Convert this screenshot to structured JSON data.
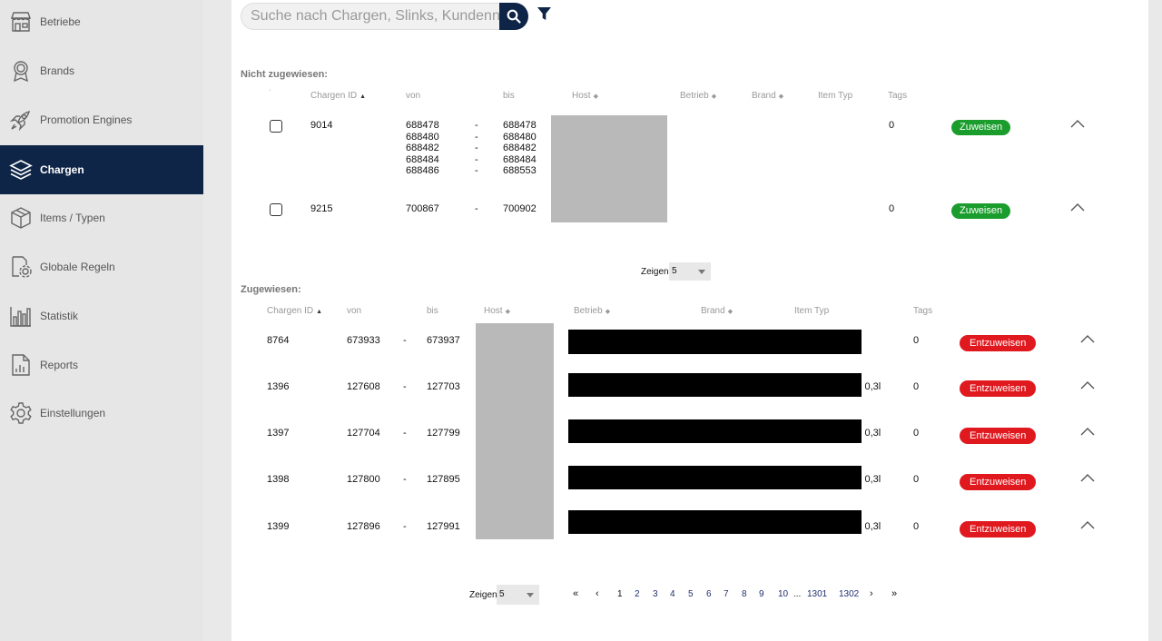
{
  "sidebar": {
    "items": [
      {
        "label": "Betriebe",
        "icon": "store-icon",
        "active": false
      },
      {
        "label": "Brands",
        "icon": "award-icon",
        "active": false
      },
      {
        "label": "Promotion Engines",
        "icon": "rocket-icon",
        "active": false
      },
      {
        "label": "Chargen",
        "icon": "layers-icon",
        "active": true
      },
      {
        "label": "Items / Typen",
        "icon": "box-icon",
        "active": false
      },
      {
        "label": "Globale Regeln",
        "icon": "settings-doc-icon",
        "active": false
      },
      {
        "label": "Statistik",
        "icon": "bar-chart-icon",
        "active": false
      },
      {
        "label": "Reports",
        "icon": "report-icon",
        "active": false
      },
      {
        "label": "Einstellungen",
        "icon": "gear-icon",
        "active": false
      }
    ]
  },
  "search": {
    "placeholder": "Suche nach Chargen, Slinks, Kundennummer"
  },
  "unassigned": {
    "title": "Nicht zugewiesen:",
    "headers": {
      "id": "Chargen ID",
      "from": "von",
      "to": "bis",
      "host": "Host",
      "betrieb": "Betrieb",
      "brand": "Brand",
      "item_type": "Item Typ",
      "tags": "Tags"
    },
    "rows": [
      {
        "id": "9014",
        "from": "688478\n688480\n688482\n688484\n688486",
        "dash": "-\n-\n-\n-\n-",
        "to": "688478\n688480\n688482\n688484\n688553",
        "tags": "0",
        "action": "Zuweisen"
      },
      {
        "id": "9215",
        "from": "700867",
        "dash": "-",
        "to": "700902",
        "tags": "0",
        "action": "Zuweisen"
      }
    ],
    "show_label": "Zeigen",
    "show_value": "5"
  },
  "assigned": {
    "title": "Zugewiesen:",
    "headers": {
      "id": "Chargen ID",
      "from": "von",
      "to": "bis",
      "host": "Host",
      "betrieb": "Betrieb",
      "brand": "Brand",
      "item_type": "Item Typ",
      "tags": "Tags"
    },
    "rows": [
      {
        "id": "8764",
        "from": "673933",
        "dash": "-",
        "to": "673937",
        "item_type": "",
        "tags": "0",
        "action": "Entzuweisen"
      },
      {
        "id": "1396",
        "from": "127608",
        "dash": "-",
        "to": "127703",
        "item_type": "l 0,3l",
        "tags": "0",
        "action": "Entzuweisen"
      },
      {
        "id": "1397",
        "from": "127704",
        "dash": "-",
        "to": "127799",
        "item_type": "l 0,3l",
        "tags": "0",
        "action": "Entzuweisen"
      },
      {
        "id": "1398",
        "from": "127800",
        "dash": "-",
        "to": "127895",
        "item_type": "l 0,3l",
        "tags": "0",
        "action": "Entzuweisen"
      },
      {
        "id": "1399",
        "from": "127896",
        "dash": "-",
        "to": "127991",
        "item_type": "l 0,3l",
        "tags": "0",
        "action": "Entzuweisen"
      }
    ],
    "show_label": "Zeigen",
    "show_value": "5"
  },
  "pagination": {
    "first": "«",
    "prev": "‹",
    "next": "›",
    "last": "»",
    "pages": [
      "1",
      "2",
      "3",
      "4",
      "5",
      "6",
      "7",
      "8",
      "9",
      "10"
    ],
    "ellipsis": "...",
    "tail": [
      "1301",
      "1302"
    ],
    "current": "1"
  },
  "colors": {
    "sidebar_active": "#0f2548",
    "assign": "#1a9d2c",
    "unassign": "#e0191f",
    "host_redacted": "#b9b9b9"
  }
}
